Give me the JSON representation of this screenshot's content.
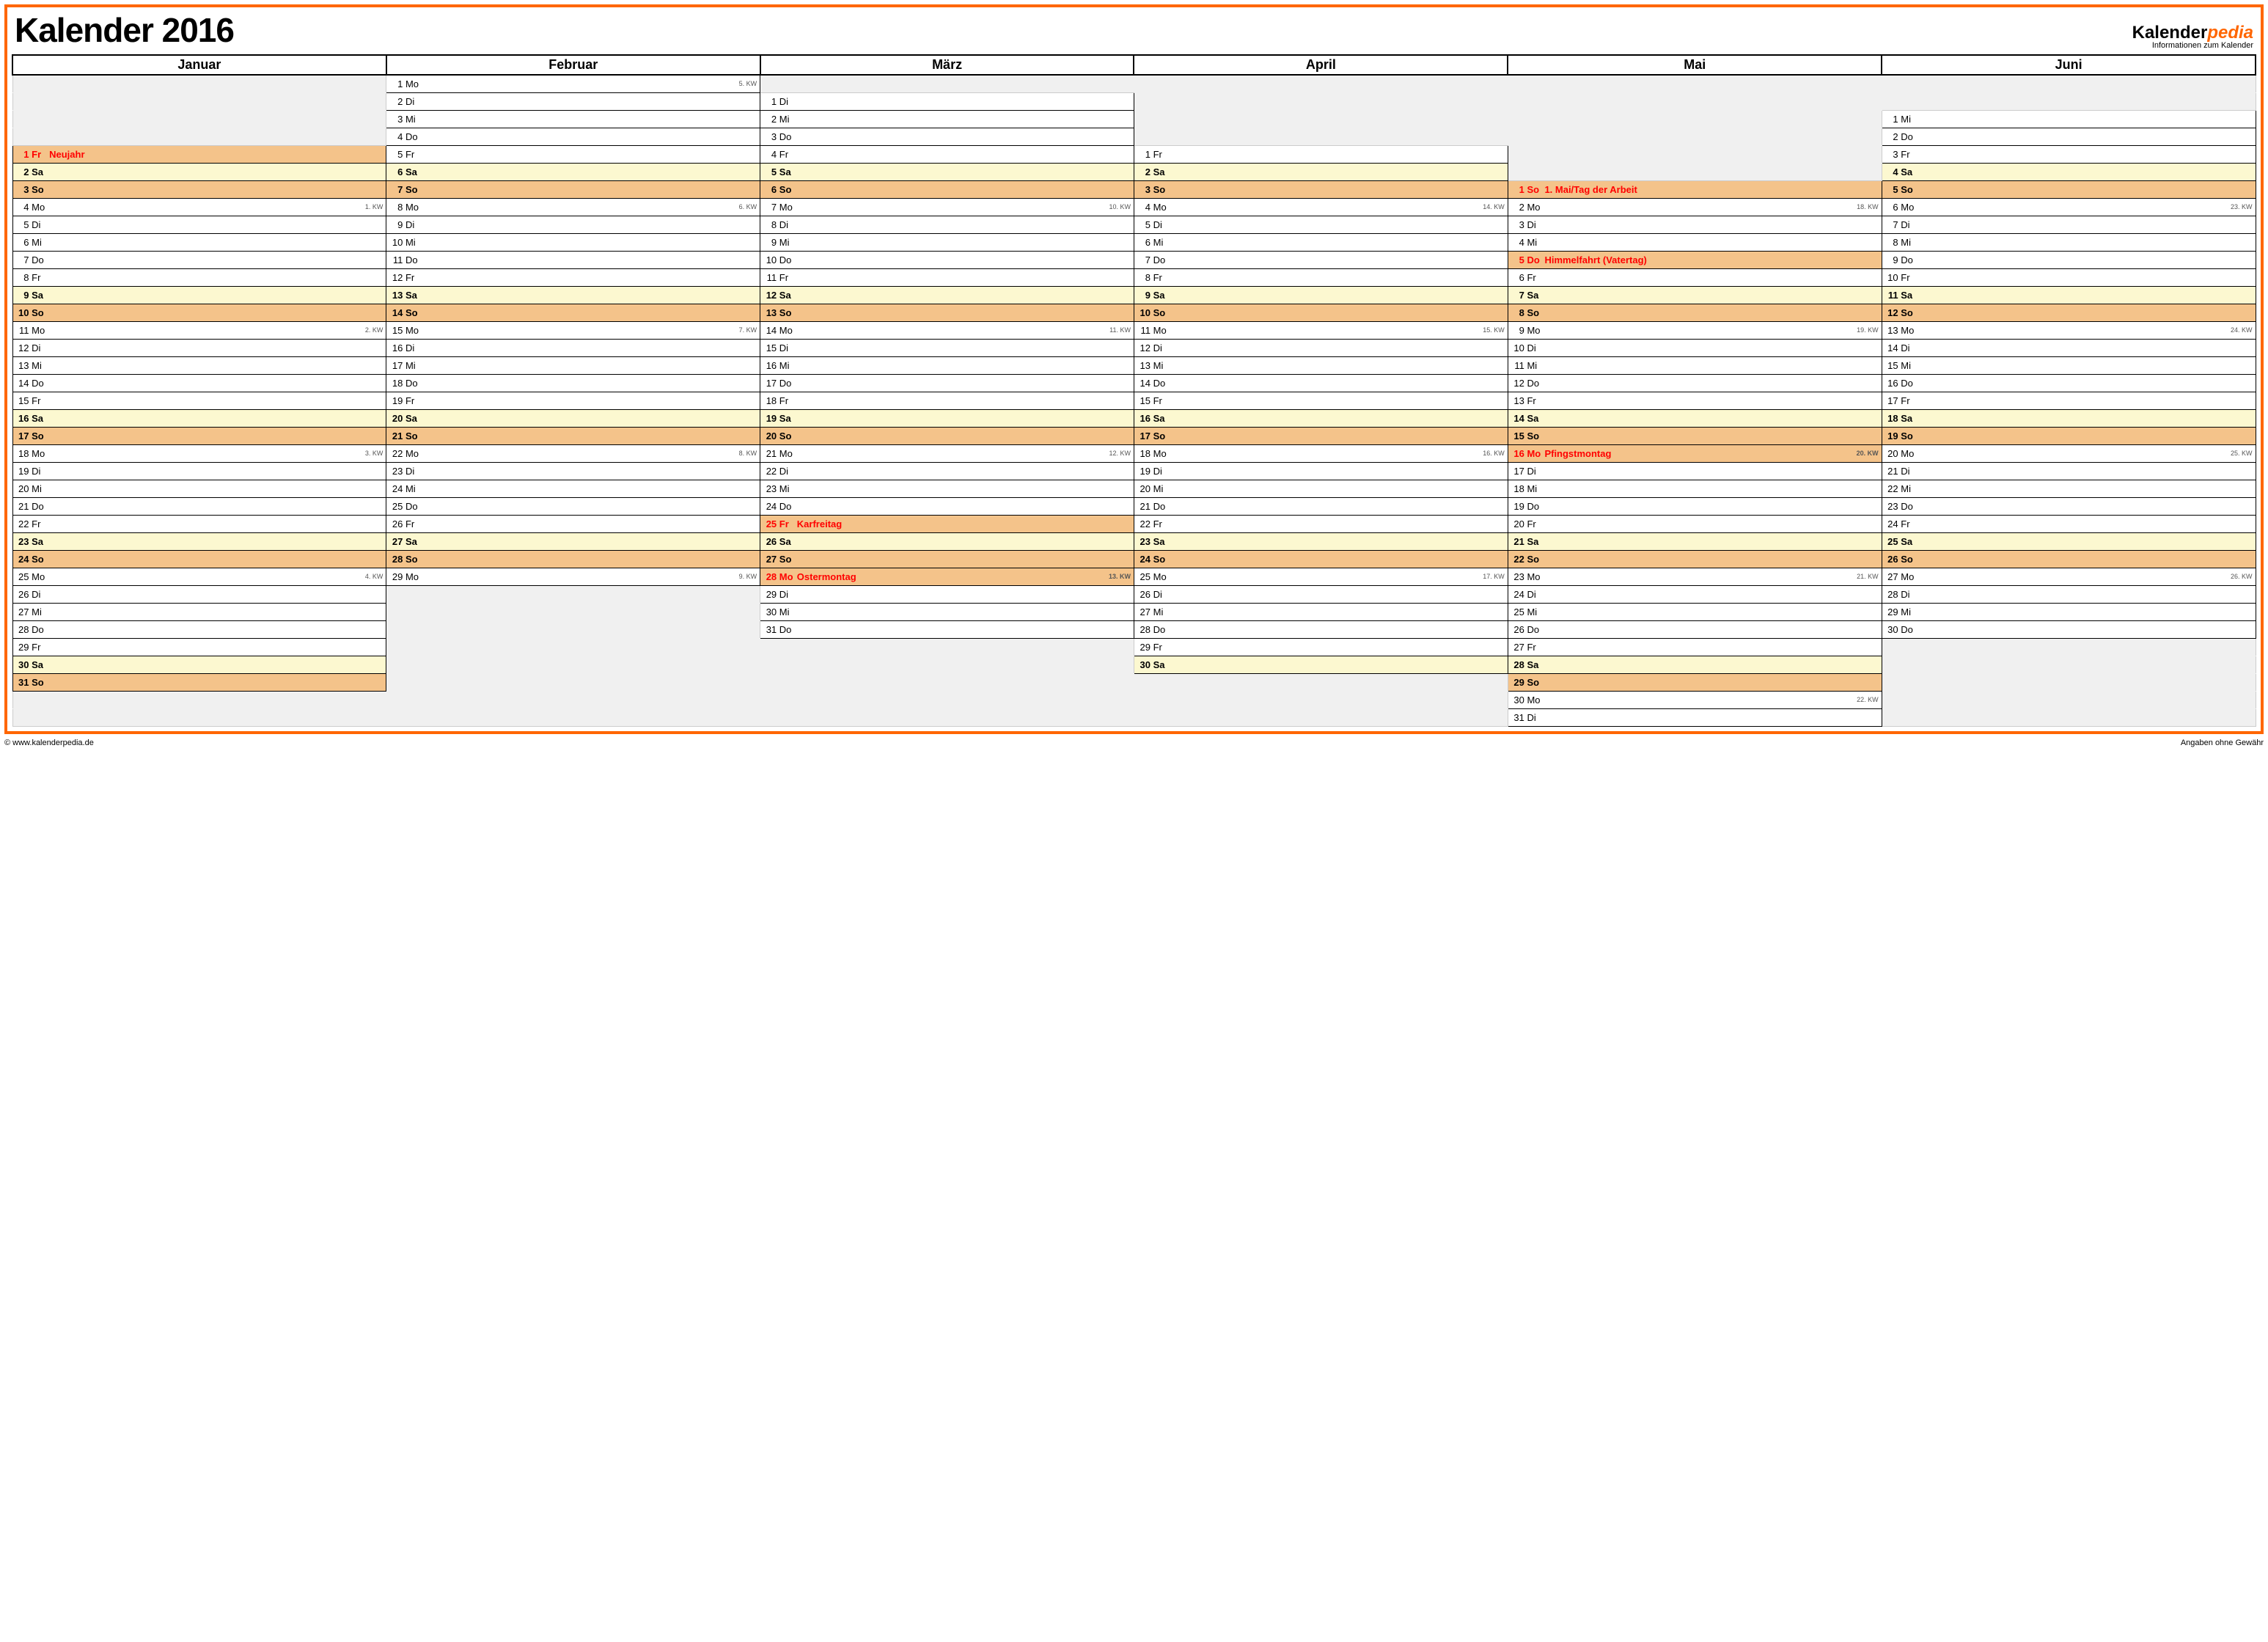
{
  "title": "Kalender 2016",
  "brand_prefix": "Kalender",
  "brand_suffix": "pedia",
  "brand_sub": "Informationen zum Kalender",
  "footer_left": "© www.kalenderpedia.de",
  "footer_right": "Angaben ohne Gewähr",
  "months": [
    "Januar",
    "Februar",
    "März",
    "April",
    "Mai",
    "Juni"
  ],
  "maxRows": 35,
  "cols": [
    {
      "offset": 4,
      "days": [
        {
          "d": 1,
          "w": "Fr",
          "hol": "Neujahr",
          "type": "holiday-red"
        },
        {
          "d": 2,
          "w": "Sa",
          "type": "sa"
        },
        {
          "d": 3,
          "w": "So",
          "type": "so"
        },
        {
          "d": 4,
          "w": "Mo",
          "kw": "1. KW"
        },
        {
          "d": 5,
          "w": "Di"
        },
        {
          "d": 6,
          "w": "Mi"
        },
        {
          "d": 7,
          "w": "Do"
        },
        {
          "d": 8,
          "w": "Fr"
        },
        {
          "d": 9,
          "w": "Sa",
          "type": "sa"
        },
        {
          "d": 10,
          "w": "So",
          "type": "so"
        },
        {
          "d": 11,
          "w": "Mo",
          "kw": "2. KW"
        },
        {
          "d": 12,
          "w": "Di"
        },
        {
          "d": 13,
          "w": "Mi"
        },
        {
          "d": 14,
          "w": "Do"
        },
        {
          "d": 15,
          "w": "Fr"
        },
        {
          "d": 16,
          "w": "Sa",
          "type": "sa"
        },
        {
          "d": 17,
          "w": "So",
          "type": "so"
        },
        {
          "d": 18,
          "w": "Mo",
          "kw": "3. KW"
        },
        {
          "d": 19,
          "w": "Di"
        },
        {
          "d": 20,
          "w": "Mi"
        },
        {
          "d": 21,
          "w": "Do"
        },
        {
          "d": 22,
          "w": "Fr"
        },
        {
          "d": 23,
          "w": "Sa",
          "type": "sa"
        },
        {
          "d": 24,
          "w": "So",
          "type": "so"
        },
        {
          "d": 25,
          "w": "Mo",
          "kw": "4. KW"
        },
        {
          "d": 26,
          "w": "Di"
        },
        {
          "d": 27,
          "w": "Mi"
        },
        {
          "d": 28,
          "w": "Do"
        },
        {
          "d": 29,
          "w": "Fr"
        },
        {
          "d": 30,
          "w": "Sa",
          "type": "sa"
        },
        {
          "d": 31,
          "w": "So",
          "type": "so"
        }
      ]
    },
    {
      "offset": 0,
      "days": [
        {
          "d": 1,
          "w": "Mo",
          "kw": "5. KW"
        },
        {
          "d": 2,
          "w": "Di"
        },
        {
          "d": 3,
          "w": "Mi"
        },
        {
          "d": 4,
          "w": "Do"
        },
        {
          "d": 5,
          "w": "Fr"
        },
        {
          "d": 6,
          "w": "Sa",
          "type": "sa"
        },
        {
          "d": 7,
          "w": "So",
          "type": "so"
        },
        {
          "d": 8,
          "w": "Mo",
          "kw": "6. KW"
        },
        {
          "d": 9,
          "w": "Di"
        },
        {
          "d": 10,
          "w": "Mi"
        },
        {
          "d": 11,
          "w": "Do"
        },
        {
          "d": 12,
          "w": "Fr"
        },
        {
          "d": 13,
          "w": "Sa",
          "type": "sa"
        },
        {
          "d": 14,
          "w": "So",
          "type": "so"
        },
        {
          "d": 15,
          "w": "Mo",
          "kw": "7. KW"
        },
        {
          "d": 16,
          "w": "Di"
        },
        {
          "d": 17,
          "w": "Mi"
        },
        {
          "d": 18,
          "w": "Do"
        },
        {
          "d": 19,
          "w": "Fr"
        },
        {
          "d": 20,
          "w": "Sa",
          "type": "sa"
        },
        {
          "d": 21,
          "w": "So",
          "type": "so"
        },
        {
          "d": 22,
          "w": "Mo",
          "kw": "8. KW"
        },
        {
          "d": 23,
          "w": "Di"
        },
        {
          "d": 24,
          "w": "Mi"
        },
        {
          "d": 25,
          "w": "Do"
        },
        {
          "d": 26,
          "w": "Fr"
        },
        {
          "d": 27,
          "w": "Sa",
          "type": "sa"
        },
        {
          "d": 28,
          "w": "So",
          "type": "so"
        },
        {
          "d": 29,
          "w": "Mo",
          "kw": "9. KW"
        }
      ]
    },
    {
      "offset": 1,
      "days": [
        {
          "d": 1,
          "w": "Di"
        },
        {
          "d": 2,
          "w": "Mi"
        },
        {
          "d": 3,
          "w": "Do"
        },
        {
          "d": 4,
          "w": "Fr"
        },
        {
          "d": 5,
          "w": "Sa",
          "type": "sa"
        },
        {
          "d": 6,
          "w": "So",
          "type": "so"
        },
        {
          "d": 7,
          "w": "Mo",
          "kw": "10. KW"
        },
        {
          "d": 8,
          "w": "Di"
        },
        {
          "d": 9,
          "w": "Mi"
        },
        {
          "d": 10,
          "w": "Do"
        },
        {
          "d": 11,
          "w": "Fr"
        },
        {
          "d": 12,
          "w": "Sa",
          "type": "sa"
        },
        {
          "d": 13,
          "w": "So",
          "type": "so"
        },
        {
          "d": 14,
          "w": "Mo",
          "kw": "11. KW"
        },
        {
          "d": 15,
          "w": "Di"
        },
        {
          "d": 16,
          "w": "Mi"
        },
        {
          "d": 17,
          "w": "Do"
        },
        {
          "d": 18,
          "w": "Fr"
        },
        {
          "d": 19,
          "w": "Sa",
          "type": "sa"
        },
        {
          "d": 20,
          "w": "So",
          "type": "so"
        },
        {
          "d": 21,
          "w": "Mo",
          "kw": "12. KW"
        },
        {
          "d": 22,
          "w": "Di"
        },
        {
          "d": 23,
          "w": "Mi"
        },
        {
          "d": 24,
          "w": "Do"
        },
        {
          "d": 25,
          "w": "Fr",
          "hol": "Karfreitag",
          "type": "holiday-red"
        },
        {
          "d": 26,
          "w": "Sa",
          "type": "sa"
        },
        {
          "d": 27,
          "w": "So",
          "type": "so"
        },
        {
          "d": 28,
          "w": "Mo",
          "hol": "Ostermontag",
          "type": "holiday-red",
          "kw": "13. KW"
        },
        {
          "d": 29,
          "w": "Di"
        },
        {
          "d": 30,
          "w": "Mi"
        },
        {
          "d": 31,
          "w": "Do"
        }
      ]
    },
    {
      "offset": 4,
      "days": [
        {
          "d": 1,
          "w": "Fr"
        },
        {
          "d": 2,
          "w": "Sa",
          "type": "sa"
        },
        {
          "d": 3,
          "w": "So",
          "type": "so"
        },
        {
          "d": 4,
          "w": "Mo",
          "kw": "14. KW"
        },
        {
          "d": 5,
          "w": "Di"
        },
        {
          "d": 6,
          "w": "Mi"
        },
        {
          "d": 7,
          "w": "Do"
        },
        {
          "d": 8,
          "w": "Fr"
        },
        {
          "d": 9,
          "w": "Sa",
          "type": "sa"
        },
        {
          "d": 10,
          "w": "So",
          "type": "so"
        },
        {
          "d": 11,
          "w": "Mo",
          "kw": "15. KW"
        },
        {
          "d": 12,
          "w": "Di"
        },
        {
          "d": 13,
          "w": "Mi"
        },
        {
          "d": 14,
          "w": "Do"
        },
        {
          "d": 15,
          "w": "Fr"
        },
        {
          "d": 16,
          "w": "Sa",
          "type": "sa"
        },
        {
          "d": 17,
          "w": "So",
          "type": "so"
        },
        {
          "d": 18,
          "w": "Mo",
          "kw": "16. KW"
        },
        {
          "d": 19,
          "w": "Di"
        },
        {
          "d": 20,
          "w": "Mi"
        },
        {
          "d": 21,
          "w": "Do"
        },
        {
          "d": 22,
          "w": "Fr"
        },
        {
          "d": 23,
          "w": "Sa",
          "type": "sa"
        },
        {
          "d": 24,
          "w": "So",
          "type": "so"
        },
        {
          "d": 25,
          "w": "Mo",
          "kw": "17. KW"
        },
        {
          "d": 26,
          "w": "Di"
        },
        {
          "d": 27,
          "w": "Mi"
        },
        {
          "d": 28,
          "w": "Do"
        },
        {
          "d": 29,
          "w": "Fr"
        },
        {
          "d": 30,
          "w": "Sa",
          "type": "sa"
        }
      ]
    },
    {
      "offset": 6,
      "days": [
        {
          "d": 1,
          "w": "So",
          "hol": "1. Mai/Tag der Arbeit",
          "type": "holiday-red so"
        },
        {
          "d": 2,
          "w": "Mo",
          "kw": "18. KW"
        },
        {
          "d": 3,
          "w": "Di"
        },
        {
          "d": 4,
          "w": "Mi"
        },
        {
          "d": 5,
          "w": "Do",
          "hol": "Himmelfahrt (Vatertag)",
          "type": "holiday-red"
        },
        {
          "d": 6,
          "w": "Fr"
        },
        {
          "d": 7,
          "w": "Sa",
          "type": "sa"
        },
        {
          "d": 8,
          "w": "So",
          "type": "so"
        },
        {
          "d": 9,
          "w": "Mo",
          "kw": "19. KW"
        },
        {
          "d": 10,
          "w": "Di"
        },
        {
          "d": 11,
          "w": "Mi"
        },
        {
          "d": 12,
          "w": "Do"
        },
        {
          "d": 13,
          "w": "Fr"
        },
        {
          "d": 14,
          "w": "Sa",
          "type": "sa"
        },
        {
          "d": 15,
          "w": "So",
          "type": "so"
        },
        {
          "d": 16,
          "w": "Mo",
          "hol": "Pfingstmontag",
          "type": "holiday-red",
          "kw": "20. KW"
        },
        {
          "d": 17,
          "w": "Di"
        },
        {
          "d": 18,
          "w": "Mi"
        },
        {
          "d": 19,
          "w": "Do"
        },
        {
          "d": 20,
          "w": "Fr"
        },
        {
          "d": 21,
          "w": "Sa",
          "type": "sa"
        },
        {
          "d": 22,
          "w": "So",
          "type": "so"
        },
        {
          "d": 23,
          "w": "Mo",
          "kw": "21. KW"
        },
        {
          "d": 24,
          "w": "Di"
        },
        {
          "d": 25,
          "w": "Mi"
        },
        {
          "d": 26,
          "w": "Do"
        },
        {
          "d": 27,
          "w": "Fr"
        },
        {
          "d": 28,
          "w": "Sa",
          "type": "sa"
        },
        {
          "d": 29,
          "w": "So",
          "type": "so"
        },
        {
          "d": 30,
          "w": "Mo",
          "kw": "22. KW"
        },
        {
          "d": 31,
          "w": "Di"
        }
      ]
    },
    {
      "offset": 2,
      "days": [
        {
          "d": 1,
          "w": "Mi"
        },
        {
          "d": 2,
          "w": "Do"
        },
        {
          "d": 3,
          "w": "Fr"
        },
        {
          "d": 4,
          "w": "Sa",
          "type": "sa"
        },
        {
          "d": 5,
          "w": "So",
          "type": "so"
        },
        {
          "d": 6,
          "w": "Mo",
          "kw": "23. KW"
        },
        {
          "d": 7,
          "w": "Di"
        },
        {
          "d": 8,
          "w": "Mi"
        },
        {
          "d": 9,
          "w": "Do"
        },
        {
          "d": 10,
          "w": "Fr"
        },
        {
          "d": 11,
          "w": "Sa",
          "type": "sa"
        },
        {
          "d": 12,
          "w": "So",
          "type": "so"
        },
        {
          "d": 13,
          "w": "Mo",
          "kw": "24. KW"
        },
        {
          "d": 14,
          "w": "Di"
        },
        {
          "d": 15,
          "w": "Mi"
        },
        {
          "d": 16,
          "w": "Do"
        },
        {
          "d": 17,
          "w": "Fr"
        },
        {
          "d": 18,
          "w": "Sa",
          "type": "sa"
        },
        {
          "d": 19,
          "w": "So",
          "type": "so"
        },
        {
          "d": 20,
          "w": "Mo",
          "kw": "25. KW"
        },
        {
          "d": 21,
          "w": "Di"
        },
        {
          "d": 22,
          "w": "Mi"
        },
        {
          "d": 23,
          "w": "Do"
        },
        {
          "d": 24,
          "w": "Fr"
        },
        {
          "d": 25,
          "w": "Sa",
          "type": "sa"
        },
        {
          "d": 26,
          "w": "So",
          "type": "so"
        },
        {
          "d": 27,
          "w": "Mo",
          "kw": "26. KW"
        },
        {
          "d": 28,
          "w": "Di"
        },
        {
          "d": 29,
          "w": "Mi"
        },
        {
          "d": 30,
          "w": "Do"
        }
      ]
    }
  ]
}
